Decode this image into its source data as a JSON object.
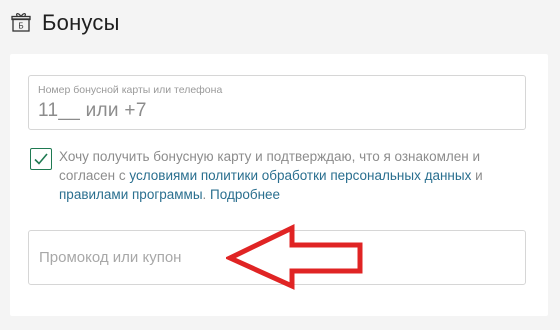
{
  "header": {
    "title": "Бонусы",
    "icon": "gift-icon",
    "icon_letter": "Б"
  },
  "bonus_card": {
    "label": "Номер бонусной карты или телефона",
    "value": "11__ или +7"
  },
  "consent": {
    "checked": true,
    "text_before": "Хочу получить бонусную карту и подтверждаю, что я ознакомлен и согласен с ",
    "link_policy": "условиями политики обработки персональных данных",
    "text_and": " и ",
    "link_rules": "правилами программы",
    "text_dot": ". ",
    "link_more": "Подробнее"
  },
  "promo": {
    "placeholder": "Промокод или купон"
  },
  "colors": {
    "accent_green": "#1f7a52",
    "link_blue": "#2a6f8f",
    "annotation_red": "#e02424"
  }
}
